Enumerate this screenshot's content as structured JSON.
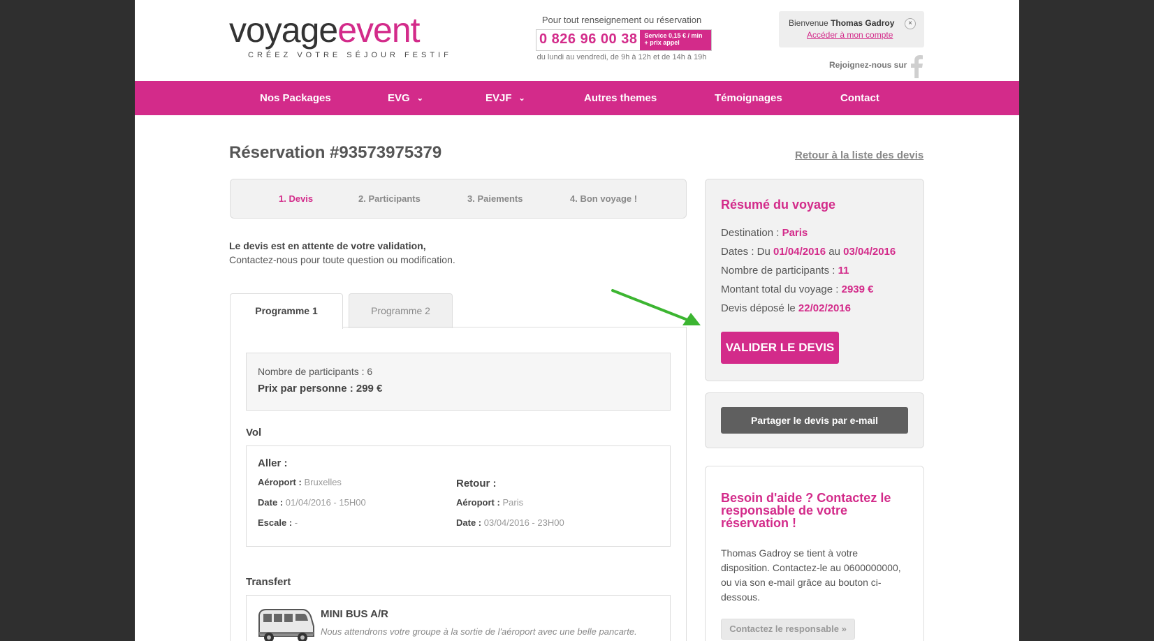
{
  "header": {
    "logo_part1": "voyage",
    "logo_part2": "event",
    "tagline": "CRÉEZ VOTRE SÉJOUR FESTIF",
    "contact_label": "Pour tout renseignement ou réservation",
    "phone": "0 826 96 00 38",
    "phone_service_line1": "Service 0,15 € / min",
    "phone_service_line2": "+ prix appel",
    "hours": "du lundi au vendredi, de 9h à 12h et de 14h à 19h",
    "welcome_prefix": "Bienvenue",
    "welcome_name": "Thomas Gadroy",
    "account_link": "Accéder à mon compte",
    "close_glyph": "×",
    "join_label": "Rejoignez-nous sur",
    "social_icon": "facebook-icon"
  },
  "nav": {
    "items": [
      "Nos Packages",
      "EVG",
      "EVJF",
      "Autres themes",
      "Témoignages",
      "Contact"
    ],
    "dropdown_glyph": "⌄"
  },
  "reservation": {
    "title": "Réservation #93573975379",
    "back_link": "Retour à la liste des devis"
  },
  "steps": [
    "1. Devis",
    "2. Participants",
    "3. Paiements",
    "4. Bon voyage !"
  ],
  "intro": {
    "line1": "Le devis est en attente de votre validation,",
    "line2": "Contactez-nous pour toute question ou modification."
  },
  "tabs": [
    "Programme 1",
    "Programme 2"
  ],
  "program": {
    "participants": "Nombre de participants : 6",
    "price": "Prix par personne : 299 €",
    "vol_title": "Vol",
    "aller_title": "Aller :",
    "aller_airport_label": "Aéroport :",
    "aller_airport": "Bruxelles",
    "aller_date_label": "Date :",
    "aller_date": "01/04/2016 - 15H00",
    "aller_escale_label": "Escale :",
    "aller_escale": "-",
    "retour_title": "Retour :",
    "retour_airport_label": "Aéroport :",
    "retour_airport": "Paris",
    "retour_date_label": "Date :",
    "retour_date": "03/04/2016 - 23H00",
    "transfert_title": "Transfert",
    "transfert_name": "MINI BUS A/R",
    "transfert_desc": "Nous attendrons votre groupe à la sortie de l'aéroport avec une belle pancarte."
  },
  "summary": {
    "title": "Résumé du voyage",
    "destination_label": "Destination :",
    "destination": "Paris",
    "dates_label": "Dates : Du",
    "date_from": "01/04/2016",
    "dates_mid": "au",
    "date_to": "03/04/2016",
    "participants_label": "Nombre de participants :",
    "participants": "11",
    "amount_label": "Montant total du voyage :",
    "amount": "2939 €",
    "deposit_label": "Devis déposé le",
    "deposit_date": "22/02/2016",
    "validate_button": "VALIDER LE DEVIS"
  },
  "share": {
    "button": "Partager le devis par e-mail"
  },
  "help": {
    "title": "Besoin d'aide ? Contactez le responsable de votre réservation !",
    "text": "Thomas Gadroy se tient à votre disposition. Contactez-le au 0600000000, ou via son e-mail grâce au bouton ci-dessous.",
    "button": "Contactez le responsable »"
  },
  "colors": {
    "brand": "#d32b8a",
    "annotation_arrow": "#3cb531",
    "background": "#2f2f2f"
  }
}
